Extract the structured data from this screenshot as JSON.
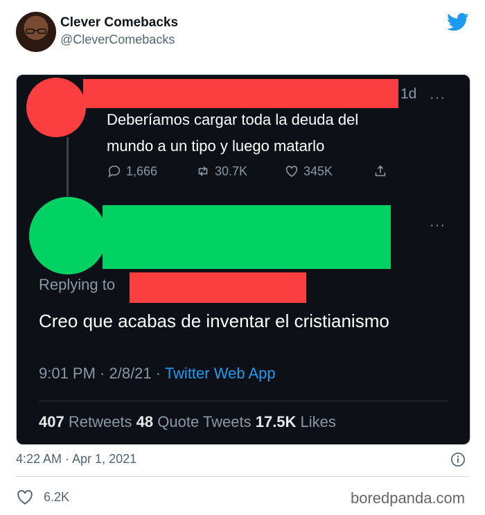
{
  "author": {
    "name": "Clever Comebacks",
    "handle": "@CleverComebacks"
  },
  "screenshot": {
    "tweet1": {
      "age": "1d",
      "more": "···",
      "text_line1": "Deberíamos cargar toda la deuda del",
      "text_line2": "mundo a un tipo y luego matarlo",
      "replies": "1,666",
      "retweets": "30.7K",
      "likes": "345K"
    },
    "tweet2": {
      "more": "···",
      "replying_to": "Replying to",
      "text": "Creo que acabas de inventar el cristianismo",
      "time": "9:01 PM · 2/8/21 · ",
      "app": "Twitter Web App",
      "retweets_count": "407",
      "retweets_label": " Retweets ",
      "quote_count": "48",
      "quote_label": " Quote Tweets ",
      "likes_count": "17.5K",
      "likes_label": " Likes"
    }
  },
  "timestamp": "4:22 AM · Apr 1, 2021",
  "likes": "6.2K",
  "watermark": "boredpanda.com",
  "colors": {
    "redact_red": "#fb3e3f",
    "redact_green": "#02d264",
    "twitter_blue": "#1d9bf0"
  },
  "icons": [
    "twitter-bird-icon",
    "reply-icon",
    "retweet-icon",
    "heart-icon",
    "share-icon",
    "info-icon"
  ]
}
